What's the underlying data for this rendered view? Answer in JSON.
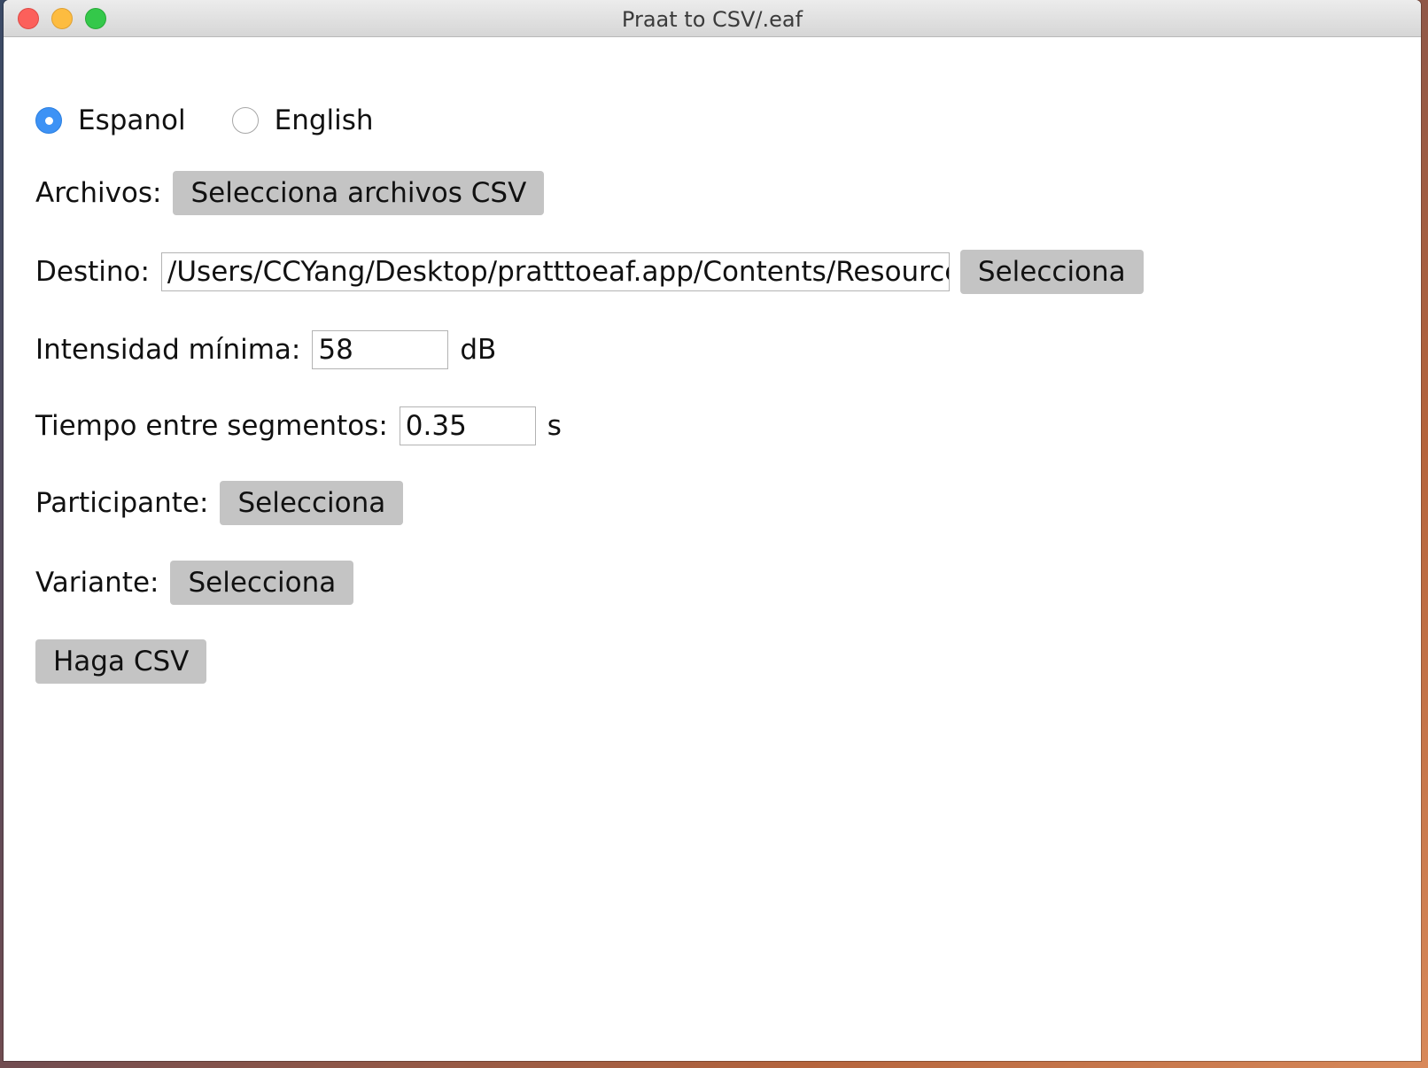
{
  "window": {
    "title": "Praat to CSV/.eaf"
  },
  "language": {
    "options": [
      {
        "label": "Espanol",
        "selected": true
      },
      {
        "label": "English",
        "selected": false
      }
    ]
  },
  "files": {
    "label": "Archivos:",
    "button": "Selecciona archivos CSV"
  },
  "destination": {
    "label": "Destino:",
    "value": "/Users/CCYang/Desktop/pratttoeaf.app/Contents/Resources",
    "button": "Selecciona"
  },
  "intensity": {
    "label": "Intensidad mínima:",
    "value": "58",
    "unit": "dB"
  },
  "segment_time": {
    "label": "Tiempo entre segmentos:",
    "value": "0.35",
    "unit": "s"
  },
  "participant": {
    "label": "Participante:",
    "button": "Selecciona"
  },
  "variant": {
    "label": "Variante:",
    "button": "Selecciona"
  },
  "actions": {
    "make_csv": "Haga CSV"
  },
  "colors": {
    "accent": "#3d92f5",
    "button_bg": "#c4c4c4",
    "close": "#fc605b",
    "minimize": "#fdbc40",
    "maximize": "#34c84a"
  }
}
